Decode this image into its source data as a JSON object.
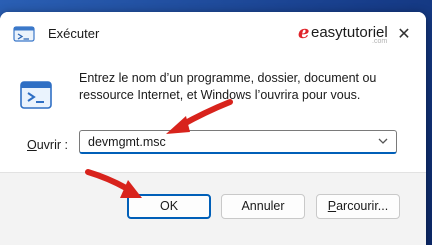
{
  "window": {
    "title": "Exécuter",
    "close_glyph": "✕"
  },
  "brand": {
    "mark": "e",
    "name": "easytutoriel",
    "domain": ".com",
    "color": "#e0232a"
  },
  "dialog": {
    "description": "Entrez le nom d’un programme, dossier, document ou ressource Internet, et Windows l’ouvrira pour vous.",
    "open_label_accel": "O",
    "open_label_rest": "uvrir :",
    "open_value": "devmgmt.msc"
  },
  "buttons": {
    "ok": "OK",
    "cancel": "Annuler",
    "browse_accel": "P",
    "browse_rest": "arcourir..."
  },
  "icons": {
    "app": "run-app-icon",
    "run": "run-dialog-icon",
    "caret": "chevron-down-icon",
    "annotation": "red-arrow-annotation"
  },
  "colors": {
    "accent": "#005fb8",
    "annotation_red": "#d8231c",
    "footer_bg": "#f3f3f3"
  }
}
